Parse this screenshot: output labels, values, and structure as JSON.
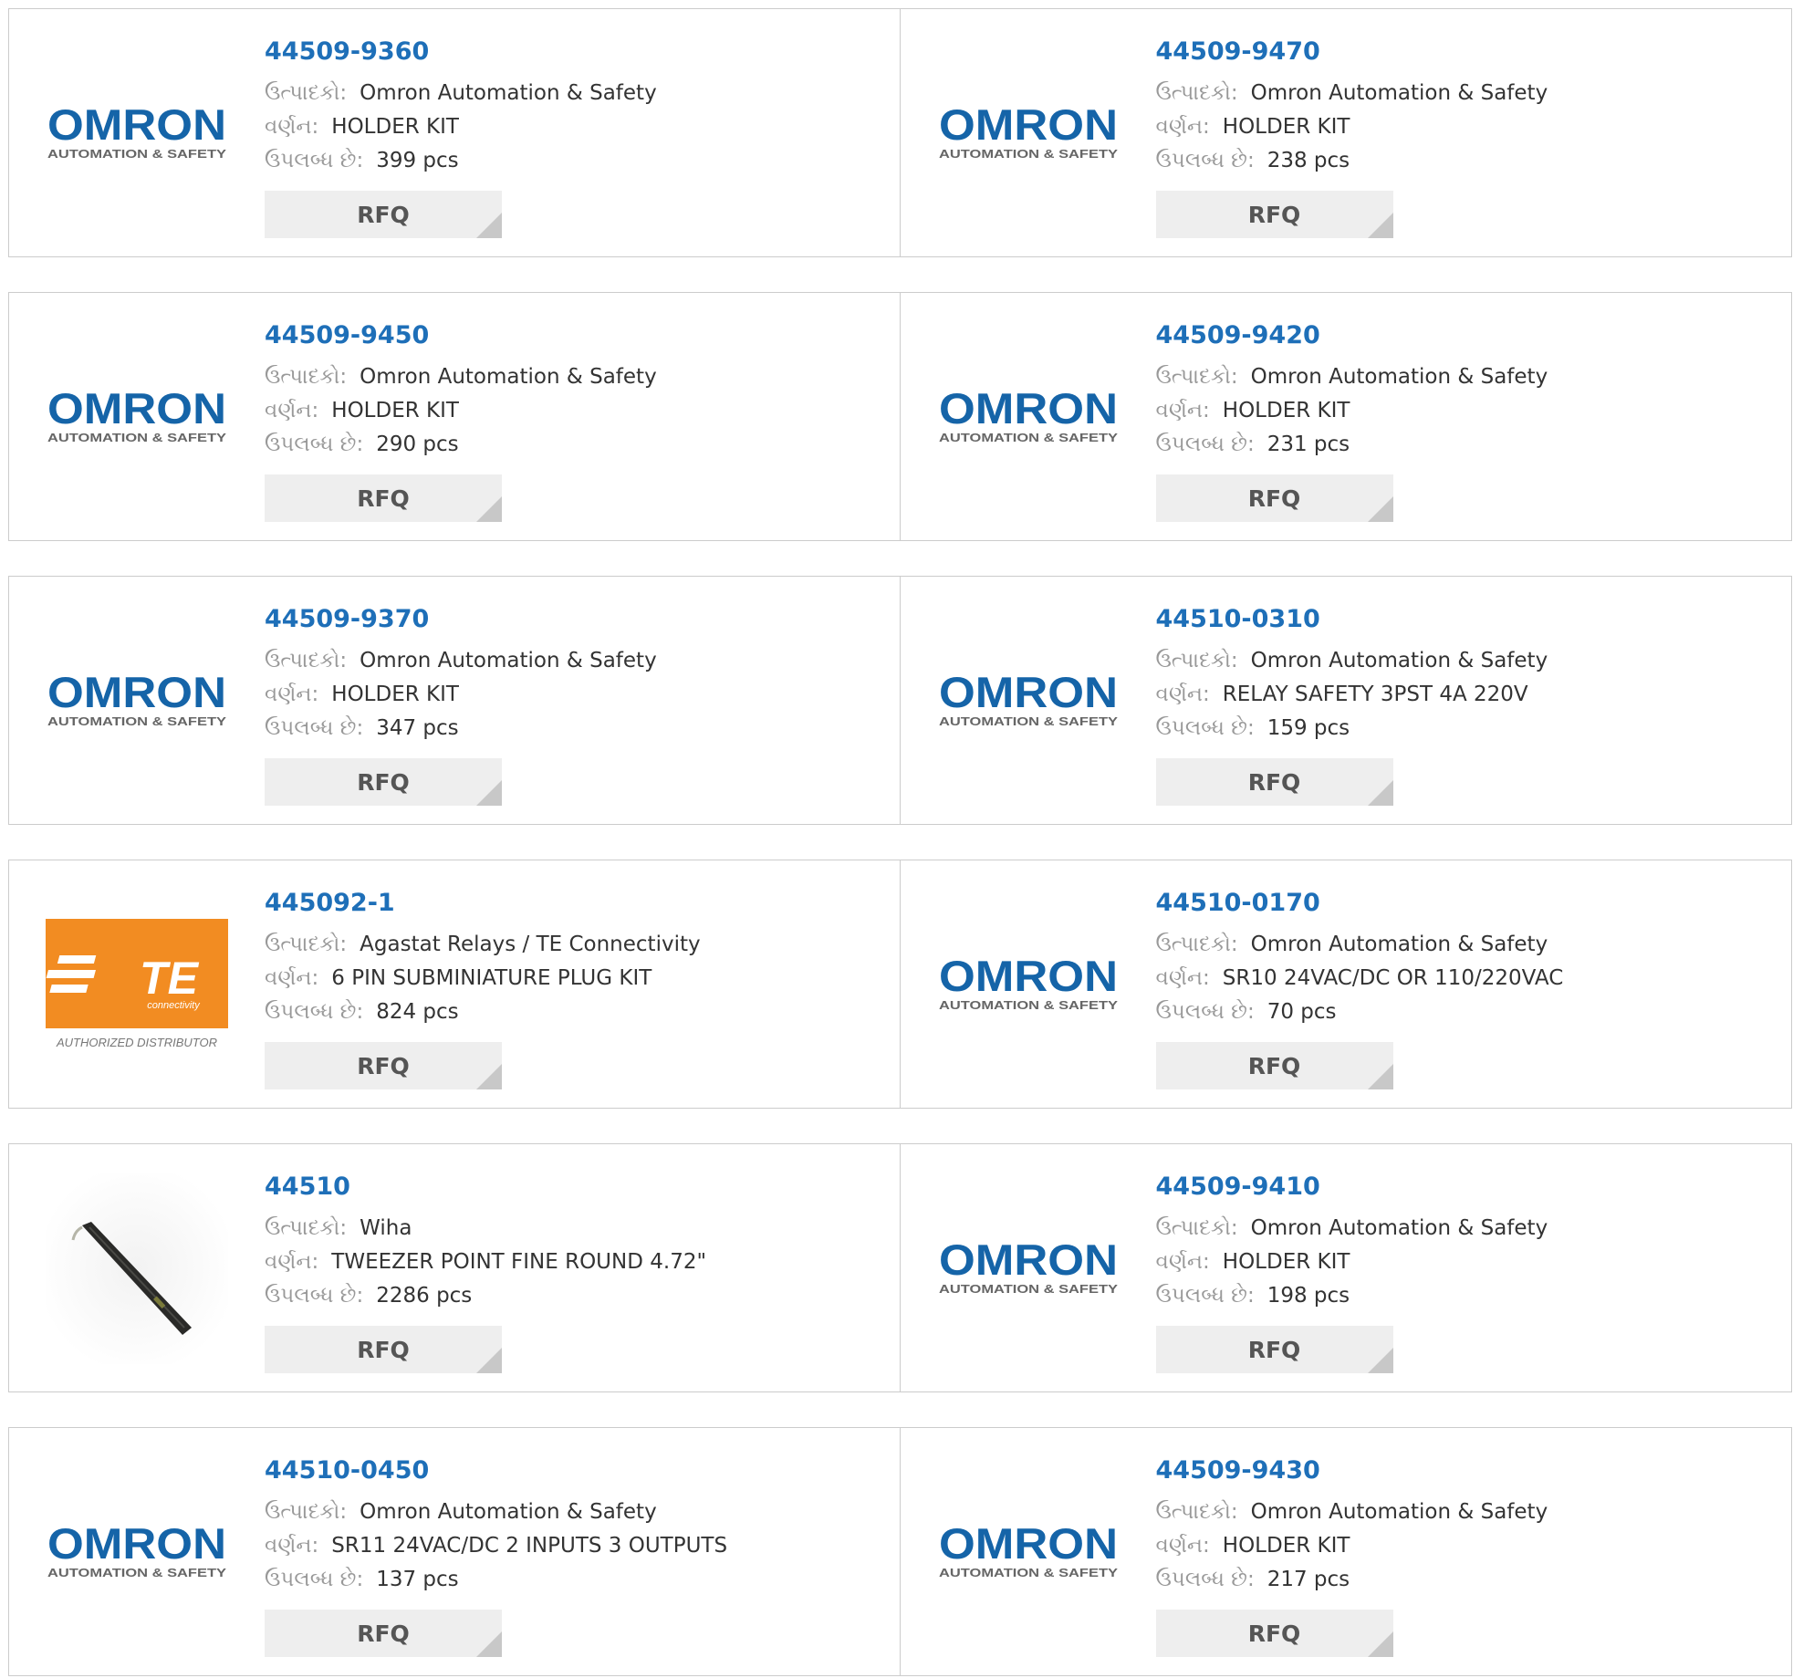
{
  "labels": {
    "manufacturer": "ઉત્પાદકો:",
    "description": "વર્ણન:",
    "available": "ઉપલબ્ધ છે:"
  },
  "colors": {
    "part_link": "#1e6fb8",
    "omron_blue": "#1564a8",
    "te_orange": "#f28c22",
    "button_bg": "#eeeeee"
  },
  "logos": {
    "omron": {
      "icon": "omron-logo",
      "word": "OMRON",
      "tag": "AUTOMATION & SAFETY"
    },
    "te": {
      "icon": "te-connectivity-logo",
      "word": "TE",
      "sub": "connectivity",
      "tag": "AUTHORIZED DISTRIBUTOR"
    },
    "wiha": {
      "icon": "tweezer-product-image"
    }
  },
  "products": [
    {
      "part": "44509-9360",
      "manufacturer": "Omron Automation & Safety",
      "description": "HOLDER KIT",
      "available": "399 pcs",
      "button": "RFQ",
      "logo": "omron"
    },
    {
      "part": "44509-9470",
      "manufacturer": "Omron Automation & Safety",
      "description": "HOLDER KIT",
      "available": "238 pcs",
      "button": "RFQ",
      "logo": "omron"
    },
    {
      "part": "44509-9450",
      "manufacturer": "Omron Automation & Safety",
      "description": "HOLDER KIT",
      "available": "290 pcs",
      "button": "RFQ",
      "logo": "omron"
    },
    {
      "part": "44509-9420",
      "manufacturer": "Omron Automation & Safety",
      "description": "HOLDER KIT",
      "available": "231 pcs",
      "button": "RFQ",
      "logo": "omron"
    },
    {
      "part": "44509-9370",
      "manufacturer": "Omron Automation & Safety",
      "description": "HOLDER KIT",
      "available": "347 pcs",
      "button": "RFQ",
      "logo": "omron"
    },
    {
      "part": "44510-0310",
      "manufacturer": "Omron Automation & Safety",
      "description": "RELAY SAFETY 3PST 4A 220V",
      "available": "159 pcs",
      "button": "RFQ",
      "logo": "omron"
    },
    {
      "part": "445092-1",
      "manufacturer": "Agastat Relays / TE Connectivity",
      "description": "6 PIN SUBMINIATURE PLUG KIT",
      "available": "824 pcs",
      "button": "RFQ",
      "logo": "te"
    },
    {
      "part": "44510-0170",
      "manufacturer": "Omron Automation & Safety",
      "description": "SR10 24VAC/DC OR 110/220VAC",
      "available": "70 pcs",
      "button": "RFQ",
      "logo": "omron"
    },
    {
      "part": "44510",
      "manufacturer": "Wiha",
      "description": "TWEEZER POINT FINE ROUND 4.72\"",
      "available": "2286 pcs",
      "button": "RFQ",
      "logo": "wiha"
    },
    {
      "part": "44509-9410",
      "manufacturer": "Omron Automation & Safety",
      "description": "HOLDER KIT",
      "available": "198 pcs",
      "button": "RFQ",
      "logo": "omron"
    },
    {
      "part": "44510-0450",
      "manufacturer": "Omron Automation & Safety",
      "description": "SR11 24VAC/DC 2 INPUTS 3 OUTPUTS",
      "available": "137 pcs",
      "button": "RFQ",
      "logo": "omron"
    },
    {
      "part": "44509-9430",
      "manufacturer": "Omron Automation & Safety",
      "description": "HOLDER KIT",
      "available": "217 pcs",
      "button": "RFQ",
      "logo": "omron"
    }
  ]
}
